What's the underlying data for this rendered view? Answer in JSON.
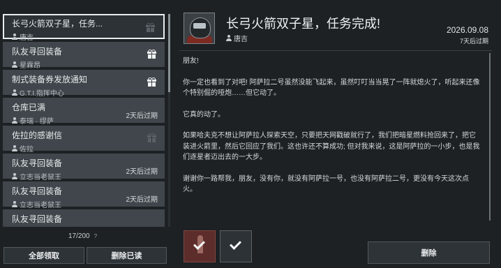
{
  "list": {
    "items": [
      {
        "title": "长弓火箭双子星，任务...",
        "sender": "唐吉",
        "gift": "dim",
        "expire": ""
      },
      {
        "title": "队友寻回装备",
        "sender": "星霖昂",
        "gift": "yes",
        "expire": ""
      },
      {
        "title": "制式装备券发放通知",
        "sender": "G.T.I.指挥中心",
        "gift": "yes",
        "expire": ""
      },
      {
        "title": "仓库已满",
        "sender": "泰瑞 · 缪萨",
        "gift": "",
        "expire": "2天后过期"
      },
      {
        "title": "佐拉的感谢信",
        "sender": "佐拉",
        "gift": "dim",
        "expire": ""
      },
      {
        "title": "队友寻回装备",
        "sender": "立志当老鼠王",
        "gift": "",
        "expire": "2天后过期"
      },
      {
        "title": "队友寻回装备",
        "sender": "立志当老鼠王",
        "gift": "",
        "expire": "2天后过期"
      },
      {
        "title": "队友寻回装备",
        "sender": "",
        "gift": "",
        "expire": ""
      }
    ],
    "counter": "17/200",
    "counter_help": "?"
  },
  "buttons": {
    "claim_all": "全部领取",
    "delete_read": "删除已读",
    "delete": "删除"
  },
  "detail": {
    "title": "长弓火箭双子星，任务完成!",
    "sender": "唐吉",
    "date": "2026.09.08",
    "expire": "7天后过期",
    "paragraphs": [
      "朋友!",
      "你一定也看到了对吧! 阿萨拉二号虽然没能飞起来，虽然叮叮当当晃了一阵就熄火了，听起来还像个特别倔的哑炮……但它动了。",
      "它真的动了。",
      "如果哈夫克不想让阿萨拉人探索天空，只要把天网戳破就行了，我们把暗星燃料抢回来了，把它装进火箭里，然后它回应了我们。这也许还不算成功; 但对我来说，这是阿萨拉的一小步，也是我们逐星者迈出去的一大步。",
      "谢谢你一路帮我，朋友，没有你，就没有阿萨拉一号，也没有阿萨拉二号，更没有今天这次点火。"
    ]
  },
  "attachments": [
    {
      "icon": "rocket-icon",
      "claimed": true
    },
    {
      "icon": "check-icon",
      "claimed": true
    }
  ],
  "colors": {
    "background": "#1d2124",
    "list_item": "#40464b",
    "selected_border": "#e8ecee",
    "attachment_red": "#5c2d2a"
  }
}
